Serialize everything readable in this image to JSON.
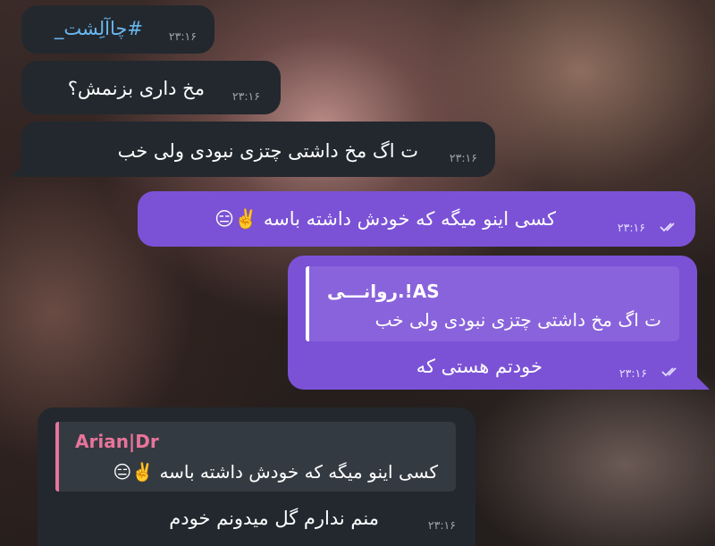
{
  "messages": [
    {
      "text": "#چاآلِشت_",
      "time": "۲۳:۱۶"
    },
    {
      "text": "مخ داری بزنمش؟",
      "time": "۲۳:۱۶"
    },
    {
      "text": "ت اگ مخ داشتی چتزی نبودی ولی خب",
      "time": "۲۳:۱۶"
    },
    {
      "text": "کسی اینو میگه که خودش داشته باسه ✌️😑",
      "time": "۲۳:۱۶"
    },
    {
      "reply": {
        "name": "AS!.روانـــی",
        "text": "ت اگ مخ داشتی چتزی نبودی ولی خب"
      },
      "text": "خودتم هستی که",
      "time": "۲۳:۱۶"
    },
    {
      "reply": {
        "name": "Arian|Dr",
        "text": "کسی اینو میگه که خودش داشته باسه ✌️😑"
      },
      "text": "منم ندارم گل میدونم خودم",
      "time": "۲۳:۱۶"
    }
  ],
  "colors": {
    "incoming_bubble": "#22282e",
    "outgoing_bubble": "#7b52d6",
    "hashtag": "#6ab7f0",
    "reply_name_out": "#ffffff",
    "reply_name_in": "#e8749a"
  }
}
